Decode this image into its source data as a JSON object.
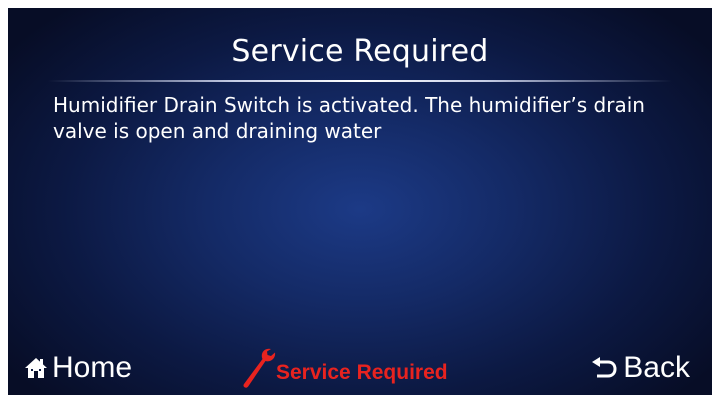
{
  "header": {
    "title": "Service Required"
  },
  "message": {
    "text": "Humidifier Drain Switch is activated. The humidifier’s drain valve is open and draining water"
  },
  "nav": {
    "home_label": "Home",
    "home_icon": "home-icon",
    "service_label": "Service Required",
    "service_icon": "wrench-icon",
    "back_label": "Back",
    "back_icon": "back-arrow-icon"
  },
  "colors": {
    "background": "#0c1943",
    "text": "#ffffff",
    "alert": "#e8231f"
  }
}
